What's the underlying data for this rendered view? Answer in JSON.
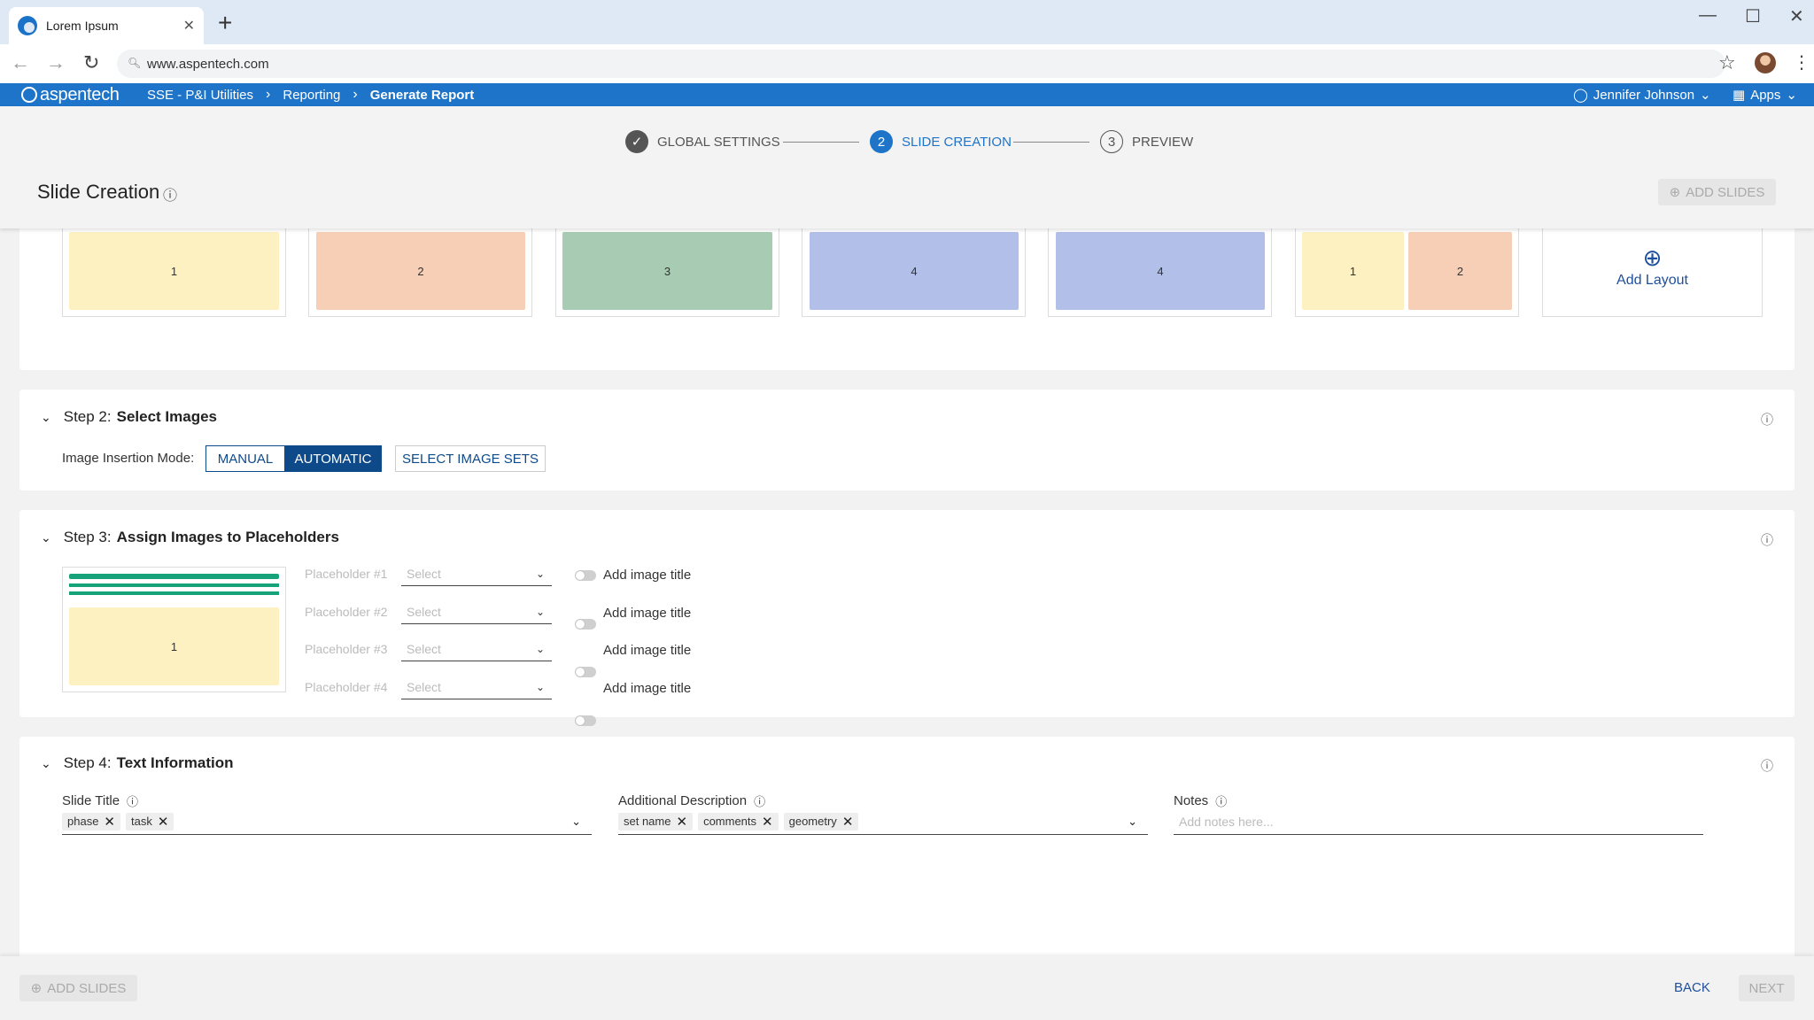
{
  "browser": {
    "tab_title": "Lorem Ipsum",
    "url": "www.aspentech.com"
  },
  "app": {
    "logo_text": "aspentech",
    "breadcrumbs": [
      "SSE - P&I Utilities",
      "Reporting",
      "Generate Report"
    ],
    "user_name": "Jennifer Johnson",
    "apps_label": "Apps"
  },
  "stepper": {
    "steps": [
      {
        "label": "GLOBAL SETTINGS",
        "state": "done"
      },
      {
        "label": "SLIDE CREATION",
        "state": "active",
        "number": "2"
      },
      {
        "label": "PREVIEW",
        "state": "todo",
        "number": "3"
      }
    ]
  },
  "header": {
    "title": "Slide Creation",
    "add_slides_label": "ADD SLIDES"
  },
  "layouts": {
    "items": [
      {
        "labels": [
          "1"
        ],
        "colors": [
          "#fdf1c1"
        ]
      },
      {
        "labels": [
          "2"
        ],
        "colors": [
          "#f7cfb6"
        ]
      },
      {
        "labels": [
          "3"
        ],
        "colors": [
          "#a8ccb3"
        ]
      },
      {
        "labels": [
          "4"
        ],
        "colors": [
          "#b2bfe8"
        ]
      },
      {
        "labels": [
          "4"
        ],
        "colors": [
          "#b2bfe8"
        ]
      },
      {
        "labels": [
          "1",
          "2"
        ],
        "colors": [
          "#fdf1c1",
          "#f7cfb6"
        ]
      }
    ],
    "add_layout_label": "Add Layout"
  },
  "step2": {
    "prefix": "Step 2:",
    "title": "Select Images",
    "mode_label": "Image Insertion Mode:",
    "manual_label": "MANUAL",
    "automatic_label": "AUTOMATIC",
    "select_sets_label": "SELECT IMAGE SETS"
  },
  "step3": {
    "prefix": "Step 3:",
    "title": "Assign Images to Placeholders",
    "preview_label": "1",
    "placeholders": [
      {
        "label": "Placeholder #1",
        "select": "Select",
        "toggle_label": "Add image title"
      },
      {
        "label": "Placeholder #2",
        "select": "Select",
        "toggle_label": "Add image title"
      },
      {
        "label": "Placeholder #3",
        "select": "Select",
        "toggle_label": "Add image title"
      },
      {
        "label": "Placeholder #4",
        "select": "Select",
        "toggle_label": "Add image title"
      }
    ]
  },
  "step4": {
    "prefix": "Step 4:",
    "title": "Text Information",
    "slide_title_label": "Slide Title",
    "slide_title_chips": [
      "phase",
      "task"
    ],
    "additional_label": "Additional Description",
    "additional_chips": [
      "set name",
      "comments",
      "geometry"
    ],
    "notes_label": "Notes",
    "notes_placeholder": "Add notes here..."
  },
  "footer": {
    "add_slides_label": "ADD SLIDES",
    "back_label": "BACK",
    "next_label": "NEXT"
  },
  "colors": {
    "primary": "#1e74c8",
    "dark_blue": "#0e4a8a",
    "accent_green": "#17a37a"
  }
}
